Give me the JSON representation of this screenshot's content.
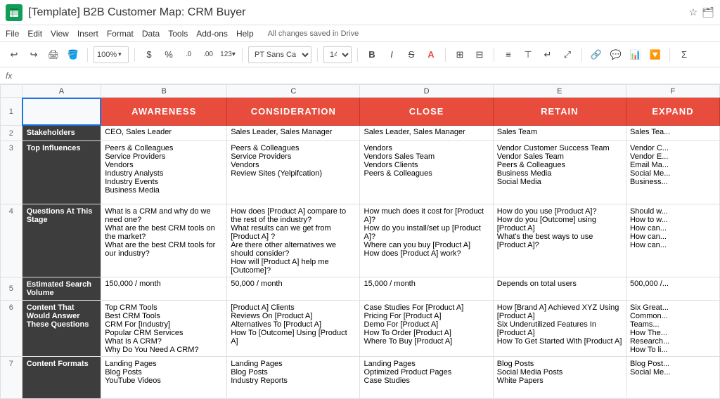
{
  "title": "[Template] B2B Customer Map: CRM Buyer",
  "saved_msg": "All changes saved in Drive",
  "menu": {
    "items": [
      "File",
      "Edit",
      "View",
      "Insert",
      "Format",
      "Data",
      "Tools",
      "Add-ons",
      "Help"
    ]
  },
  "toolbar": {
    "zoom": "100%",
    "font": "PT Sans Ca...",
    "font_size": "14"
  },
  "columns": {
    "row_header": "",
    "a_label": "A",
    "b_label": "B",
    "c_label": "C",
    "d_label": "D",
    "e_label": "E",
    "f_label": "F"
  },
  "stages": {
    "awareness": "AWARENESS",
    "consideration": "CONSIDERATION",
    "close": "CLOSE",
    "retain": "RETAIN",
    "expand": "EXPAND"
  },
  "rows": {
    "r2": {
      "label": "Stakeholders",
      "b": "CEO, Sales Leader",
      "c": "Sales Leader, Sales Manager",
      "d": "Sales Leader, Sales Manager",
      "e": "Sales Team",
      "f": "Sales Tea..."
    },
    "r3": {
      "label": "Top Influences",
      "b": "Peers & Colleagues\nService Providers\nVendors\nIndustry Analysts\nIndustry Events\nBusiness Media",
      "c": "Peers & Colleagues\nService Providers\nVendors\nReview Sites (Yelpifcation)",
      "d": "Vendors\nVendors Sales Team\nVendors Clients\nPeers & Colleagues",
      "e": "Vendor Customer Success Team\nVendor Sales Team\nPeers & Colleagues\nBusiness Media\nSocial Media",
      "f": "Vendor C...\nVendor E...\nEmail Ma...\nSocial Me...\nBusiness..."
    },
    "r4": {
      "label": "Questions At\nThis Stage",
      "b": "What is a CRM and why do we need one?\nWhat are the best CRM tools on the market?\nWhat are the best CRM tools for our industry?",
      "c": "How does [Product A] compare to the rest of the industry?\nWhat results can we get from [Product A] ?\nAre there other alternatives we should consider?\nHow will [Product A] help me [Outcome]?",
      "d": "How much does it cost for [Product A]?\nHow do you install/set up [Product A]?\nWhere can you buy [Product A]\nHow does [Product A] work?",
      "e": "How do you use [Product A]?\nHow do you [Outcome] using [Product A]\nWhat's the best ways to use [Product A]?",
      "f": "Should w...\nHow to w...\nHow can...\nHow can...\nHow can..."
    },
    "r5": {
      "label": "Estimated\nSearch Volume",
      "b": "150,000 / month",
      "c": "50,000 / month",
      "d": "15,000 / month",
      "e": "Depends on total users",
      "f": "500,000 /..."
    },
    "r6": {
      "label": "Content That\nWould Answer\nThese Questions",
      "b": "Top CRM Tools\nBest CRM Tools\nCRM For [Industry]\nPopular CRM Services\nWhat Is A CRM?\nWhy Do You Need A CRM?",
      "c": "[Product A] Clients\nReviews On [Product A]\nAlternatives To [Product A]\nHow To [Outcome] Using [Product A]",
      "d": "Case Studies For [Product A]\nPricing For [Product A]\nDemo For [Product A]\nHow To Order [Product A]\nWhere To Buy [Product A]",
      "e": "How [Brand A] Achieved XYZ Using [Product A]\nSix Underutilized Features In [Product A]\nHow To Get Started With [Product A]",
      "f": "Six Great...\nCommon...\nTeams...\nHow The...\nResearch...\nHow To li..."
    },
    "r7": {
      "label": "Content Formats",
      "b": "Landing Pages\nBlog Posts\nYouTube Videos",
      "c": "Landing Pages\nBlog Posts\nIndustry Reports",
      "d": "Landing Pages\nOptimized Product Pages\nCase Studies",
      "e": "Blog Posts\nSocial Media Posts\nWhite Papers",
      "f": "Blog Post...\nSocial Me..."
    }
  }
}
